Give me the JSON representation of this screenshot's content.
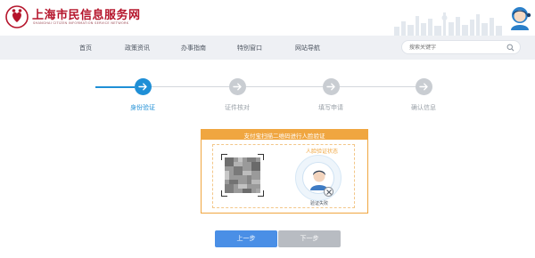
{
  "header": {
    "site_title": "上海市民信息服务网",
    "site_subtitle": "SHANGHAI CITIZEN INFORMATION SERVICE NETWORK"
  },
  "nav": {
    "items": [
      "首页",
      "政策资讯",
      "办事指南",
      "特别窗口",
      "网站导航"
    ],
    "search_placeholder": "搜索关键字"
  },
  "steps": [
    {
      "label": "身份验证",
      "active": true
    },
    {
      "label": "证件核对",
      "active": false
    },
    {
      "label": "填写申请",
      "active": false
    },
    {
      "label": "确认信息",
      "active": false
    }
  ],
  "verify": {
    "header_text": "支付宝扫描二维码进行人脸验证",
    "face_label": "人脸验证状态",
    "status_text": "验证失败"
  },
  "buttons": {
    "prev_label": "上一步",
    "next_label": "下一步"
  },
  "colors": {
    "brand_red": "#b5142b",
    "accent_blue": "#1f8fd6",
    "panel_orange": "#f0a640",
    "button_blue": "#4a8fe6",
    "button_disabled": "#b8bcc2"
  }
}
